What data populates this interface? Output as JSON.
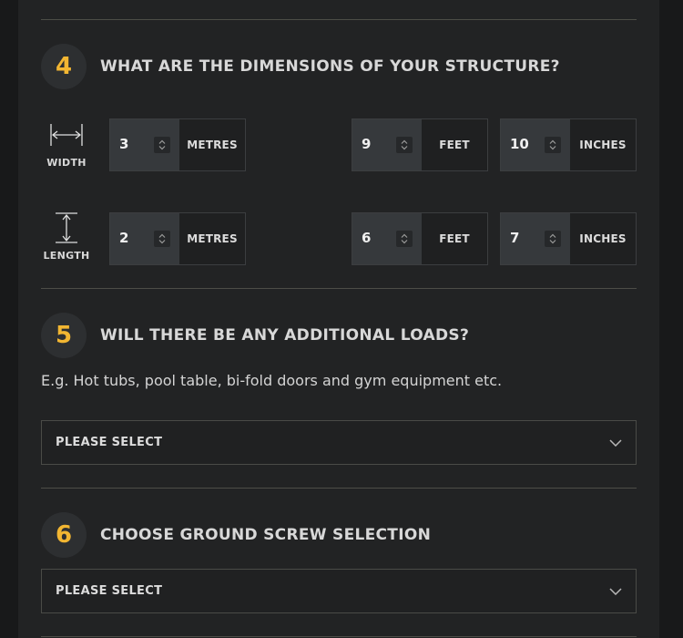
{
  "steps": {
    "dimensions": {
      "number": "4",
      "title": "WHAT ARE THE DIMENSIONS OF YOUR STRUCTURE?"
    },
    "loads": {
      "number": "5",
      "title": "WILL THERE BE ANY ADDITIONAL LOADS?",
      "hint": "E.g. Hot tubs, pool table, bi-fold doors and gym equipment etc.",
      "select_value": "PLEASE SELECT"
    },
    "screws": {
      "number": "6",
      "title": "CHOOSE GROUND SCREW SELECTION",
      "select_value": "PLEASE SELECT"
    }
  },
  "width": {
    "label": "WIDTH",
    "metres": {
      "value": "3",
      "unit": "METRES"
    },
    "feet": {
      "value": "9",
      "unit": "FEET"
    },
    "inches": {
      "value": "10",
      "unit": "INCHES"
    }
  },
  "length": {
    "label": "LENGTH",
    "metres": {
      "value": "2",
      "unit": "METRES"
    },
    "feet": {
      "value": "6",
      "unit": "FEET"
    },
    "inches": {
      "value": "7",
      "unit": "INCHES"
    }
  },
  "icons": {
    "width": "horizontal-arrow-icon",
    "length": "vertical-arrow-icon",
    "spinner": "spinner-icon",
    "dropdown": "chevron-down-icon"
  },
  "colors": {
    "accent": "#f2b632",
    "background": "#222324",
    "input": "#36393c"
  }
}
